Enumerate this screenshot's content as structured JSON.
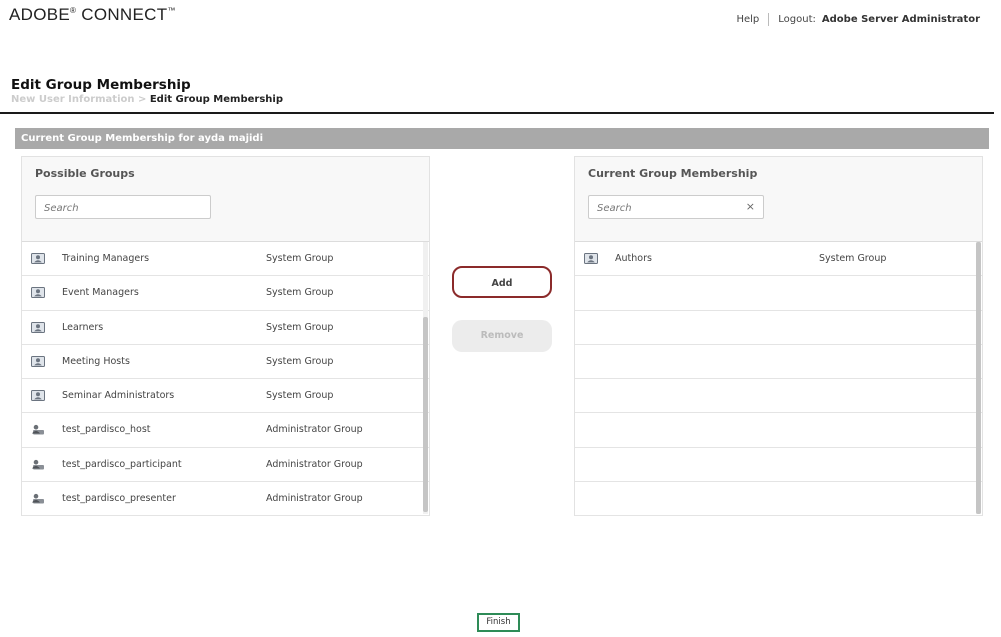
{
  "app": {
    "brand": "ADOBE",
    "brand_mark": "®",
    "brand_product": " CONNECT",
    "brand_tm": "™"
  },
  "topnav": {
    "help": "Help",
    "logout_label": "Logout:",
    "user": "Adobe Server Administrator"
  },
  "page": {
    "title": "Edit Group Membership",
    "breadcrumb_prev": "New User Information",
    "breadcrumb_sep": " > ",
    "breadcrumb_current": "Edit Group Membership",
    "section_title": "Current Group Membership for ayda majidi"
  },
  "possible": {
    "title": "Possible Groups",
    "search_placeholder": "Search",
    "rows": [
      {
        "name": "Training Managers",
        "type": "System Group",
        "icon": "system-group-icon"
      },
      {
        "name": "Event Managers",
        "type": "System Group",
        "icon": "system-group-icon"
      },
      {
        "name": "Learners",
        "type": "System Group",
        "icon": "system-group-icon"
      },
      {
        "name": "Meeting Hosts",
        "type": "System Group",
        "icon": "system-group-icon"
      },
      {
        "name": "Seminar Administrators",
        "type": "System Group",
        "icon": "system-group-icon"
      },
      {
        "name": "test_pardisco_host",
        "type": "Administrator Group",
        "icon": "administrator-group-icon"
      },
      {
        "name": "test_pardisco_participant",
        "type": "Administrator Group",
        "icon": "administrator-group-icon"
      },
      {
        "name": "test_pardisco_presenter",
        "type": "Administrator Group",
        "icon": "administrator-group-icon"
      }
    ]
  },
  "actions": {
    "add": "Add",
    "remove": "Remove",
    "finish": "Finish"
  },
  "current": {
    "title": "Current Group Membership",
    "search_placeholder": "Search",
    "clear_glyph": "×",
    "rows": [
      {
        "name": "Authors",
        "type": "System Group",
        "icon": "system-group-icon"
      }
    ]
  },
  "colors": {
    "add_border": "#8b2a2a",
    "finish_border": "#2e8b57",
    "section_bar": "#a9a9a9"
  }
}
